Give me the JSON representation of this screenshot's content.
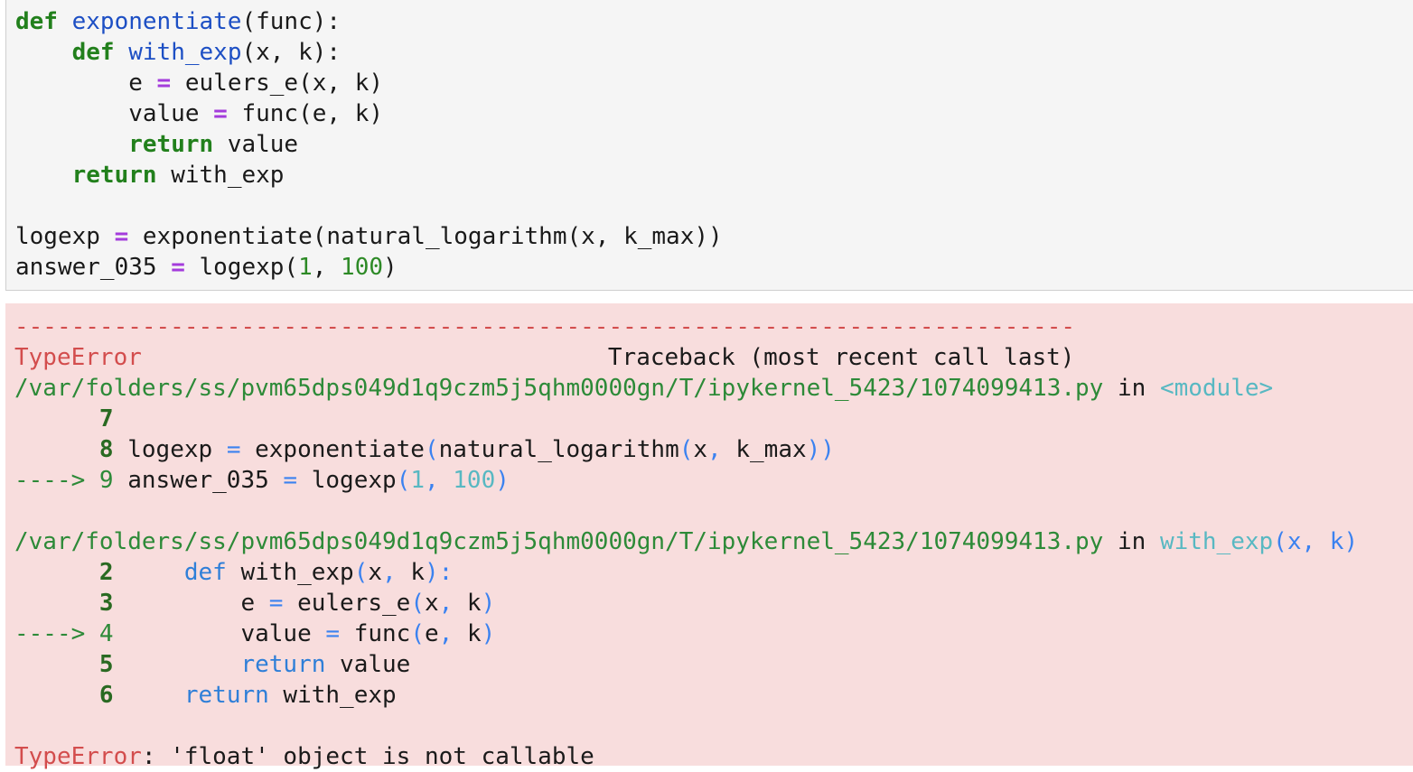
{
  "code_cell": {
    "lines": [
      [
        "def",
        " ",
        "exponentiate",
        "(func):"
      ],
      [
        "    ",
        "def",
        " ",
        "with_exp",
        "(x, k):"
      ],
      [
        "        e ",
        "=",
        " eulers_e(x, k)"
      ],
      [
        "        value ",
        "=",
        " func(e, k)"
      ],
      [
        "        ",
        "return",
        " value"
      ],
      [
        "    ",
        "return",
        " with_exp"
      ],
      [
        ""
      ],
      [
        "logexp ",
        "=",
        " exponentiate(natural_logarithm(x, k_max))"
      ],
      [
        "answer_035 ",
        "=",
        " logexp(",
        "1",
        ", ",
        "100",
        ")"
      ]
    ]
  },
  "traceback": {
    "separator": "---------------------------------------------------------------------------",
    "error_type": "TypeError",
    "header_title": "Traceback (most recent call last)",
    "frame1": {
      "path": "/var/folders/ss/pvm65dps049d1q9czm5j5qhm0000gn/T/ipykernel_5423/1074099413.py",
      "in_label": " in ",
      "location": "<module>",
      "lines": [
        {
          "marker": "      ",
          "num": "7",
          "code": ""
        },
        {
          "marker": "      ",
          "num": "8",
          "code": " logexp = exponentiate(natural_logarithm(x, k_max))"
        },
        {
          "marker": "----> ",
          "num": "9",
          "code": " answer_035 = logexp(1, 100)"
        }
      ]
    },
    "frame2": {
      "path": "/var/folders/ss/pvm65dps049d1q9czm5j5qhm0000gn/T/ipykernel_5423/1074099413.py",
      "in_label": " in ",
      "location": "with_exp",
      "location_args": "(x, k)",
      "lines": [
        {
          "marker": "      ",
          "num": "2",
          "code": "     def with_exp(x, k):"
        },
        {
          "marker": "      ",
          "num": "3",
          "code": "         e = eulers_e(x, k)"
        },
        {
          "marker": "----> ",
          "num": "4",
          "code": "         value = func(e, k)"
        },
        {
          "marker": "      ",
          "num": "5",
          "code": "         return value"
        },
        {
          "marker": "      ",
          "num": "6",
          "code": "     return with_exp"
        }
      ]
    },
    "final_error_type": "TypeError",
    "final_error_message": ": 'float' object is not callable"
  }
}
